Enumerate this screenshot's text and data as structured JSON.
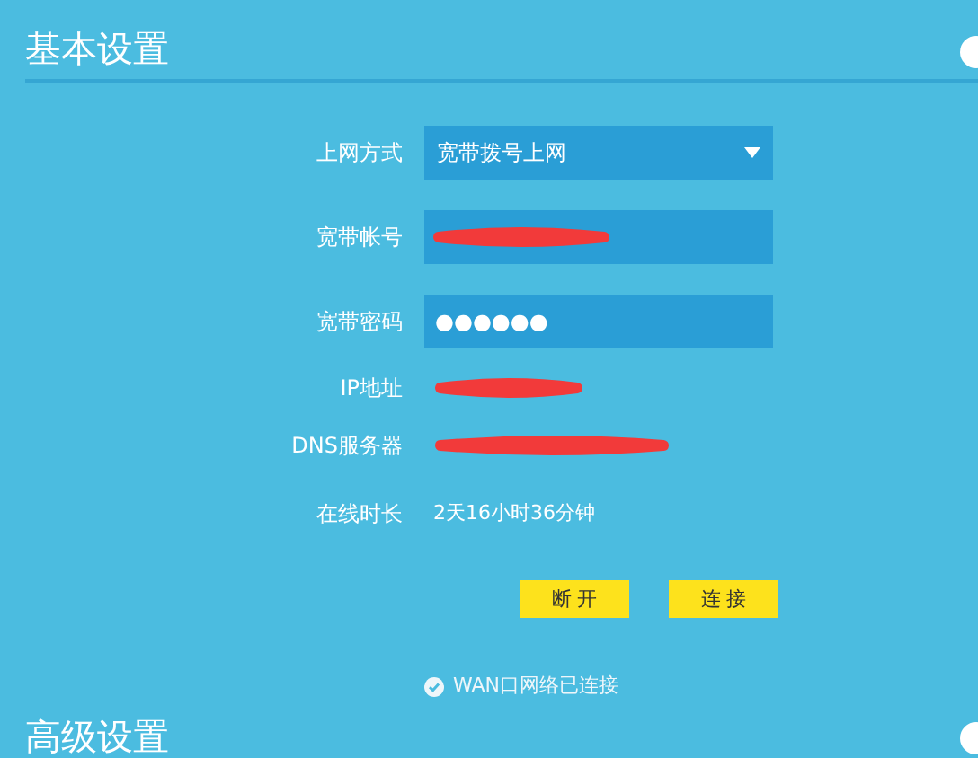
{
  "sections": [
    {
      "title": "基本设置"
    },
    {
      "title": "高级设置"
    }
  ],
  "connection_type": {
    "label": "上网方式",
    "value": "宽带拨号上网"
  },
  "account": {
    "label": "宽带帐号",
    "redacted": true
  },
  "password": {
    "label": "宽带密码",
    "value": "●●●●●●"
  },
  "info": [
    {
      "label": "IP地址",
      "redacted": true
    },
    {
      "label": "DNS服务器",
      "redacted": true
    },
    {
      "label": "在线时长",
      "redacted": false,
      "value": "2天16小时36分钟"
    }
  ],
  "buttons": [
    "断 开",
    "连 接"
  ],
  "status": {
    "text": "WAN口网络已连接",
    "ok": true
  }
}
